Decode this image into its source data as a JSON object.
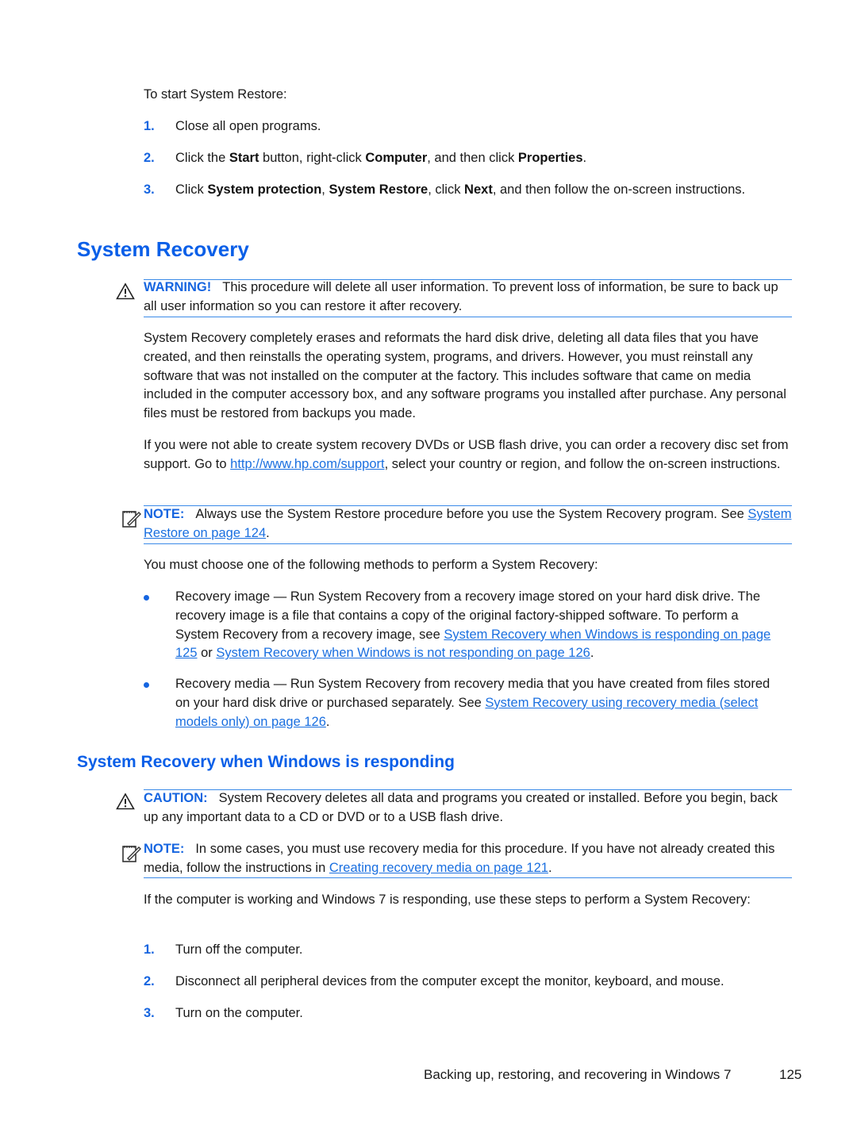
{
  "intro": "To start System Restore:",
  "restore_steps": [
    {
      "num": "1.",
      "parts": [
        {
          "t": "Close all open programs."
        }
      ]
    },
    {
      "num": "2.",
      "parts": [
        {
          "t": "Click the "
        },
        {
          "b": "Start"
        },
        {
          "t": " button, right-click "
        },
        {
          "b": "Computer"
        },
        {
          "t": ", and then click "
        },
        {
          "b": "Properties"
        },
        {
          "t": "."
        }
      ]
    },
    {
      "num": "3.",
      "parts": [
        {
          "t": "Click "
        },
        {
          "b": "System protection"
        },
        {
          "t": ", "
        },
        {
          "b": "System Restore"
        },
        {
          "t": ", click "
        },
        {
          "b": "Next"
        },
        {
          "t": ", and then follow the on-screen instructions."
        }
      ]
    }
  ],
  "heading1": "System Recovery",
  "warning": {
    "label": "WARNING!",
    "text": "This procedure will delete all user information. To prevent loss of information, be sure to back up all user information so you can restore it after recovery."
  },
  "para1": "System Recovery completely erases and reformats the hard disk drive, deleting all data files that you have created, and then reinstalls the operating system, programs, and drivers. However, you must reinstall any software that was not installed on the computer at the factory. This includes software that came on media included in the computer accessory box, and any software programs you installed after purchase. Any personal files must be restored from backups you made.",
  "para2": {
    "before": "If you were not able to create system recovery DVDs or USB flash drive, you can order a recovery disc set from support. Go to ",
    "link": "http://www.hp.com/support",
    "after": ", select your country or region, and follow the on-screen instructions."
  },
  "note1": {
    "label": "NOTE:",
    "text": "Always use the System Restore procedure before you use the System Recovery program. See ",
    "link": "System Restore on page 124",
    "after": "."
  },
  "methods_intro": "You must choose one of the following methods to perform a System Recovery:",
  "methods": [
    {
      "parts": [
        {
          "t": "Recovery image — Run System Recovery from a recovery image stored on your hard disk drive. The recovery image is a file that contains a copy of the original factory-shipped software. To perform a System Recovery from a recovery image, see "
        },
        {
          "a": "System Recovery when Windows is responding on page 125"
        },
        {
          "t": " or "
        },
        {
          "a": "System Recovery when Windows is not responding on page 126"
        },
        {
          "t": "."
        }
      ]
    },
    {
      "parts": [
        {
          "t": "Recovery media — Run System Recovery from recovery media that you have created from files stored on your hard disk drive or purchased separately. See "
        },
        {
          "a": "System Recovery using recovery media (select models only) on page 126"
        },
        {
          "t": "."
        }
      ]
    }
  ],
  "heading2": "System Recovery when Windows is responding",
  "caution": {
    "label": "CAUTION:",
    "text": "System Recovery deletes all data and programs you created or installed. Before you begin, back up any important data to a CD or DVD or to a USB flash drive."
  },
  "note2": {
    "label": "NOTE:",
    "text": "In some cases, you must use recovery media for this procedure. If you have not already created this media, follow the instructions in ",
    "link": "Creating recovery media on page 121",
    "after": "."
  },
  "para3": "If the computer is working and Windows 7 is responding, use these steps to perform a System Recovery:",
  "recovery_steps": [
    {
      "num": "1.",
      "text": "Turn off the computer."
    },
    {
      "num": "2.",
      "text": "Disconnect all peripheral devices from the computer except the monitor, keyboard, and mouse."
    },
    {
      "num": "3.",
      "text": "Turn on the computer."
    }
  ],
  "footer": {
    "chapter": "Backing up, restoring, and recovering in Windows 7",
    "page_number": "125"
  }
}
